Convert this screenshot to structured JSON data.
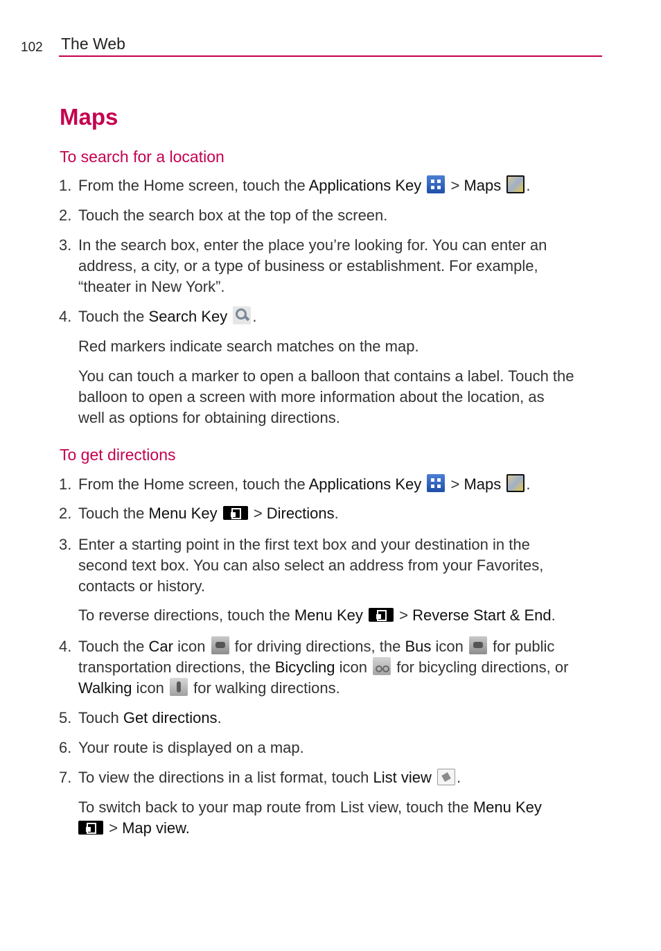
{
  "header": {
    "page_number": "102",
    "section": "The Web"
  },
  "title": "Maps",
  "search": {
    "heading": "To search for a location",
    "s1": {
      "num": "1.",
      "pre": "From the Home screen, touch the ",
      "apps_key": "Applications Key",
      "gt": " > ",
      "maps": "Maps",
      "end": "."
    },
    "s2": {
      "num": "2.",
      "text": "Touch the search box at the top of the screen."
    },
    "s3": {
      "num": "3.",
      "l1": "In the search box, enter the place you’re looking for. You can enter an",
      "l2": "address, a city, or a type of business or establishment. For example,",
      "l3": "“theater in New York”."
    },
    "s4": {
      "num": "4.",
      "pre": "Touch the ",
      "key": "Search Key",
      "end": "."
    },
    "note1": "Red markers indicate search matches on the map.",
    "note2": {
      "l1": "You can touch a marker to open a balloon that contains a label. Touch the",
      "l2": "balloon to open a screen with more information about the location, as",
      "l3": "well as options for obtaining directions."
    }
  },
  "directions": {
    "heading": "To get directions",
    "s1": {
      "num": "1.",
      "pre": "From the Home screen, touch the ",
      "apps_key": "Applications Key",
      "gt": " > ",
      "maps": "Maps",
      "end": "."
    },
    "s2": {
      "num": "2.",
      "pre": "Touch the ",
      "menu_key": "Menu Key",
      "gt": " > ",
      "item": "Directions",
      "end": "."
    },
    "s3": {
      "num": "3.",
      "l1": "Enter a starting point in the first text box and your destination in the",
      "l2": "second text box. You can also select an address from your Favorites,",
      "l3": "contacts or history."
    },
    "reverse": {
      "pre": "To reverse directions, touch the ",
      "menu_key": "Menu Key",
      "gt": " > ",
      "item": "Reverse Start & End",
      "end": "."
    },
    "s4": {
      "num": "4.",
      "a": "Touch the ",
      "car": "Car",
      "b": " icon ",
      "c": " for driving directions, the ",
      "bus": "Bus",
      "d": " icon ",
      "e": " for public",
      "f": "transportation directions, the ",
      "bicycling": "Bicycling",
      "g": " icon ",
      "h": " for bicycling directions, or",
      "walking": "Walking",
      "i": " icon ",
      "j": " for walking directions."
    },
    "s5": {
      "num": "5.",
      "pre": "Touch ",
      "item": "Get directions",
      "end": "."
    },
    "s6": {
      "num": "6.",
      "text": "Your route is displayed on a map."
    },
    "s7": {
      "num": "7.",
      "pre": "To view the directions in a list format, touch ",
      "item": "List view",
      "end": "."
    },
    "switch": {
      "pre": "To switch back to your map route from List view, touch the ",
      "menu_key": "Menu Key",
      "gt": " > ",
      "item": "Map view."
    }
  }
}
